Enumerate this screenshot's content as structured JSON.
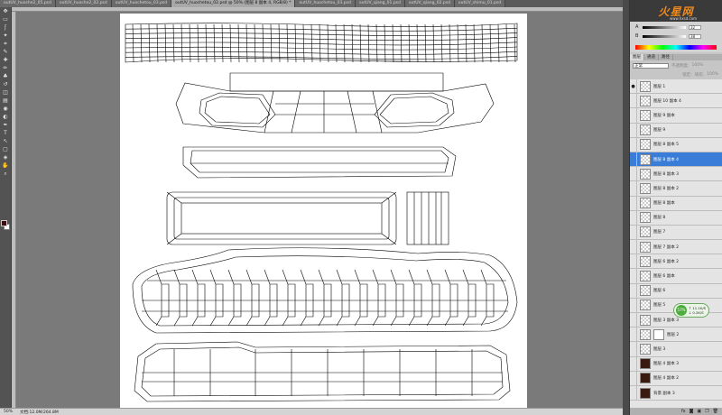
{
  "tabs": [
    {
      "label": "outUV_huoche2_05.psd",
      "active": false
    },
    {
      "label": "outUV_huoche2_02.psd",
      "active": false
    },
    {
      "label": "outUV_huochetou_03.psd",
      "active": false
    },
    {
      "label": "outUV_huochetou_02.psd @ 50% (图层 8 副本 4, RGB/8) *",
      "active": true
    },
    {
      "label": "outUV_huochetou_03.psd",
      "active": false
    },
    {
      "label": "outUV_qiang_01.psd",
      "active": false
    },
    {
      "label": "outUV_qiang_02.psd",
      "active": false
    },
    {
      "label": "outUV_shimu_01.psd",
      "active": false
    }
  ],
  "tools": [
    "move",
    "marquee",
    "lasso",
    "magic-wand",
    "crop",
    "eyedropper",
    "healing",
    "brush",
    "stamp",
    "history-brush",
    "eraser",
    "gradient",
    "blur",
    "dodge",
    "pen",
    "type",
    "path-select",
    "shape",
    "3d",
    "hand",
    "zoom"
  ],
  "tool_icons": [
    "✥",
    "▭",
    "ʃ",
    "✦",
    "⌗",
    "✎",
    "✚",
    "✏",
    "♣",
    "↺",
    "◫",
    "▤",
    "◉",
    "◐",
    "✒",
    "T",
    "↖",
    "▢",
    "◈",
    "✋",
    "⌕"
  ],
  "status": {
    "zoom": "50%",
    "doc": "文档:12.0M/264.8M"
  },
  "logo": {
    "main": "火星网",
    "sub": "www.hxsd.com"
  },
  "color": {
    "label_a": "A",
    "label_b": "B",
    "value_a": "32",
    "value_b": "38"
  },
  "layers_panel": {
    "tabs": [
      "图层",
      "通道",
      "路径"
    ],
    "blend_mode": "正常",
    "opacity_label": "不透明度:",
    "opacity_value": "100%",
    "lock_label": "锁定:",
    "fill_label": "填充:",
    "fill_value": "100%",
    "items": [
      {
        "name": "图层 1",
        "visible": true,
        "selected": false,
        "thumb": "checker"
      },
      {
        "name": "图层 10 副本 4",
        "visible": false,
        "selected": false,
        "thumb": "checker"
      },
      {
        "name": "图层 9 副本",
        "visible": false,
        "selected": false,
        "thumb": "checker"
      },
      {
        "name": "图层 9",
        "visible": false,
        "selected": false,
        "thumb": "checker"
      },
      {
        "name": "图层 8 副本 5",
        "visible": false,
        "selected": false,
        "thumb": "checker"
      },
      {
        "name": "图层 8 副本 4",
        "visible": false,
        "selected": true,
        "thumb": "checker"
      },
      {
        "name": "图层 8 副本 3",
        "visible": false,
        "selected": false,
        "thumb": "checker"
      },
      {
        "name": "图层 8 副本 2",
        "visible": false,
        "selected": false,
        "thumb": "checker"
      },
      {
        "name": "图层 8 副本",
        "visible": false,
        "selected": false,
        "thumb": "checker"
      },
      {
        "name": "图层 8",
        "visible": false,
        "selected": false,
        "thumb": "checker"
      },
      {
        "name": "图层 7",
        "visible": false,
        "selected": false,
        "thumb": "checker"
      },
      {
        "name": "图层 7 副本 2",
        "visible": false,
        "selected": false,
        "thumb": "checker"
      },
      {
        "name": "图层 6 副本 2",
        "visible": false,
        "selected": false,
        "thumb": "checker"
      },
      {
        "name": "图层 6 副本",
        "visible": false,
        "selected": false,
        "thumb": "checker"
      },
      {
        "name": "图层 6",
        "visible": false,
        "selected": false,
        "thumb": "checker"
      },
      {
        "name": "图层 5",
        "visible": false,
        "selected": false,
        "thumb": "checker"
      },
      {
        "name": "图层 3 副本 3",
        "visible": false,
        "selected": false,
        "thumb": "checker"
      },
      {
        "name": "图层 2",
        "visible": false,
        "selected": false,
        "thumb": "mask"
      },
      {
        "name": "图层 3",
        "visible": false,
        "selected": false,
        "thumb": "checker"
      },
      {
        "name": "图层 4 副本 3",
        "visible": false,
        "selected": false,
        "thumb": "dark"
      },
      {
        "name": "图层 4 副本 2",
        "visible": false,
        "selected": false,
        "thumb": "dark"
      },
      {
        "name": "背景 副本 3",
        "visible": false,
        "selected": false,
        "thumb": "dark"
      }
    ]
  },
  "widget": {
    "badge": "57%",
    "up": "↑ 11.1K/S",
    "down": "↓ 0.2K/S"
  },
  "panel_buttons": [
    "fx",
    "◙",
    "▣",
    "❐",
    "🗑"
  ]
}
